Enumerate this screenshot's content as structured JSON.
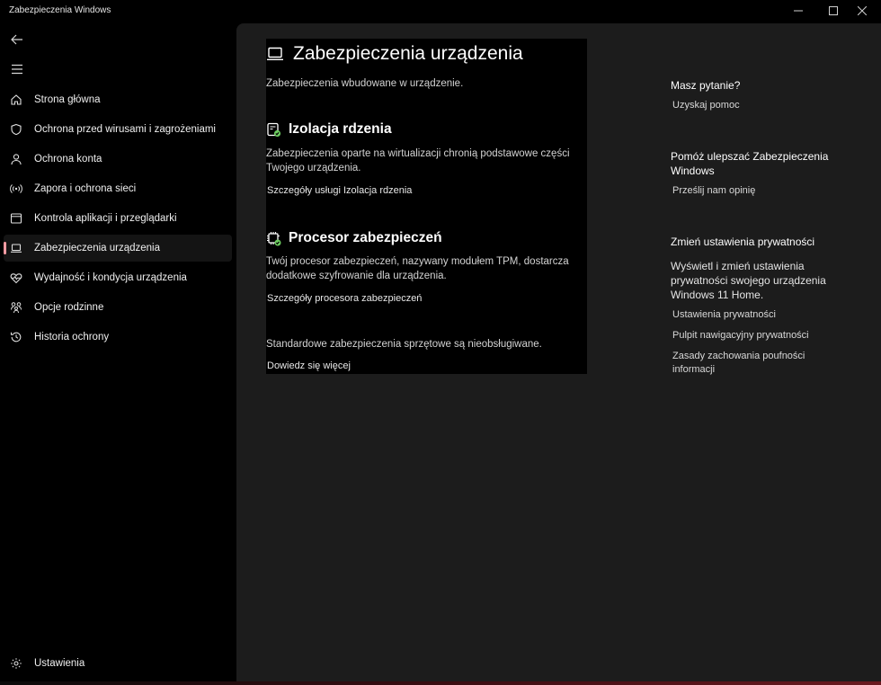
{
  "window": {
    "title": "Zabezpieczenia Windows"
  },
  "sidebar": {
    "items": [
      {
        "label": "Strona główna",
        "icon": "home-icon"
      },
      {
        "label": "Ochrona przed wirusami i zagrożeniami",
        "icon": "shield-icon"
      },
      {
        "label": "Ochrona konta",
        "icon": "person-icon"
      },
      {
        "label": "Zapora i ochrona sieci",
        "icon": "wifi-antenna-icon"
      },
      {
        "label": "Kontrola aplikacji i przeglądarki",
        "icon": "app-window-icon"
      },
      {
        "label": "Zabezpieczenia urządzenia",
        "icon": "laptop-icon"
      },
      {
        "label": "Wydajność i kondycja urządzenia",
        "icon": "heart-pulse-icon"
      },
      {
        "label": "Opcje rodzinne",
        "icon": "family-icon"
      },
      {
        "label": "Historia ochrony",
        "icon": "history-icon"
      }
    ],
    "active_index": 5,
    "settings_label": "Ustawienia"
  },
  "main": {
    "title": "Zabezpieczenia urządzenia",
    "subtitle": "Zabezpieczenia wbudowane w urządzenie.",
    "core_isolation": {
      "title": "Izolacja rdzenia",
      "desc_line1": "Zabezpieczenia oparte na wirtualizacji chronią podstawowe części",
      "desc_line2": "Twojego urządzenia.",
      "link": "Szczegóły usługi Izolacja rdzenia"
    },
    "security_processor": {
      "title": "Procesor zabezpieczeń",
      "desc_line1": "Twój procesor zabezpieczeń, nazywany modułem TPM, dostarcza",
      "desc_line2": "dodatkowe szyfrowanie dla urządzenia.",
      "link": "Szczegóły procesora zabezpieczeń"
    },
    "hardware_note": "Standardowe zabezpieczenia sprzętowe są nieobsługiwane.",
    "learn_more": "Dowiedz się więcej"
  },
  "side": {
    "question_heading": "Masz pytanie?",
    "help_link": "Uzyskaj pomoc",
    "improve_heading": "Pomóż ulepszać Zabezpieczenia Windows",
    "feedback_link": "Prześlij nam opinię",
    "privacy_heading": "Zmień ustawienia prywatności",
    "privacy_text": "Wyświetl i zmień ustawienia prywatności swojego urządzenia Windows 11 Home.",
    "privacy_links": [
      "Ustawienia prywatności",
      "Pulpit nawigacyjny prywatności",
      "Zasady zachowania poufności informacji"
    ]
  },
  "colors": {
    "accent": "#ff9ca3",
    "check": "#6ccb5f"
  }
}
